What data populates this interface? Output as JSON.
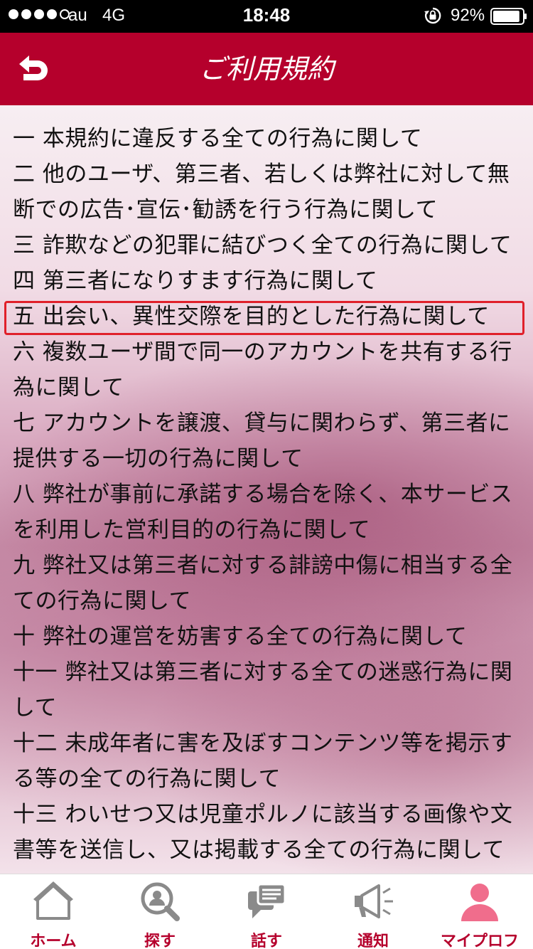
{
  "status_bar": {
    "carrier": "au",
    "network": "4G",
    "time": "18:48",
    "battery_percent": "92%",
    "battery_level": 0.92,
    "signal_bars_filled": 4,
    "signal_bars_total": 5
  },
  "header": {
    "title": "ご利用規約",
    "back_icon": "back-arrow-icon",
    "background_color": "#b5002c"
  },
  "terms": {
    "items": [
      "一 本規約に違反する全ての行為に関して",
      "二 他のユーザ、第三者、若しくは弊社に対して無断での広告･宣伝･勧誘を行う行為に関して",
      "三 詐欺などの犯罪に結びつく全ての行為に関して",
      "四 第三者になりすます行為に関して",
      "五 出会い、異性交際を目的とした行為に関して",
      "六 複数ユーザ間で同一のアカウントを共有する行為に関して",
      "七 アカウントを譲渡、貸与に関わらず、第三者に提供する一切の行為に関して",
      "八 弊社が事前に承諾する場合を除く、本サービスを利用した営利目的の行為に関して",
      "九 弊社又は第三者に対する誹謗中傷に相当する全ての行為に関して",
      "十 弊社の運営を妨害する全ての行為に関して",
      "十一 弊社又は第三者に対する全ての迷惑行為に関して",
      "十二 未成年者に害を及ぼすコンテンツ等を掲示する等の全ての行為に関して",
      "十三 わいせつ又は児童ポルノに該当する画像や文書等を送信し、又は掲載する全ての行為に関して"
    ],
    "highlighted_index": 4,
    "highlight_color": "#e0202a"
  },
  "tab_bar": {
    "tabs": [
      {
        "label": "ホーム",
        "icon": "home-icon"
      },
      {
        "label": "探す",
        "icon": "search-person-icon"
      },
      {
        "label": "話す",
        "icon": "chat-icon"
      },
      {
        "label": "通知",
        "icon": "megaphone-icon"
      },
      {
        "label": "マイプロフ",
        "icon": "profile-icon"
      }
    ],
    "active_index": 4,
    "label_color": "#b5002c",
    "active_icon_color": "#f06d8c",
    "inactive_icon_color": "#8a8a8a"
  }
}
